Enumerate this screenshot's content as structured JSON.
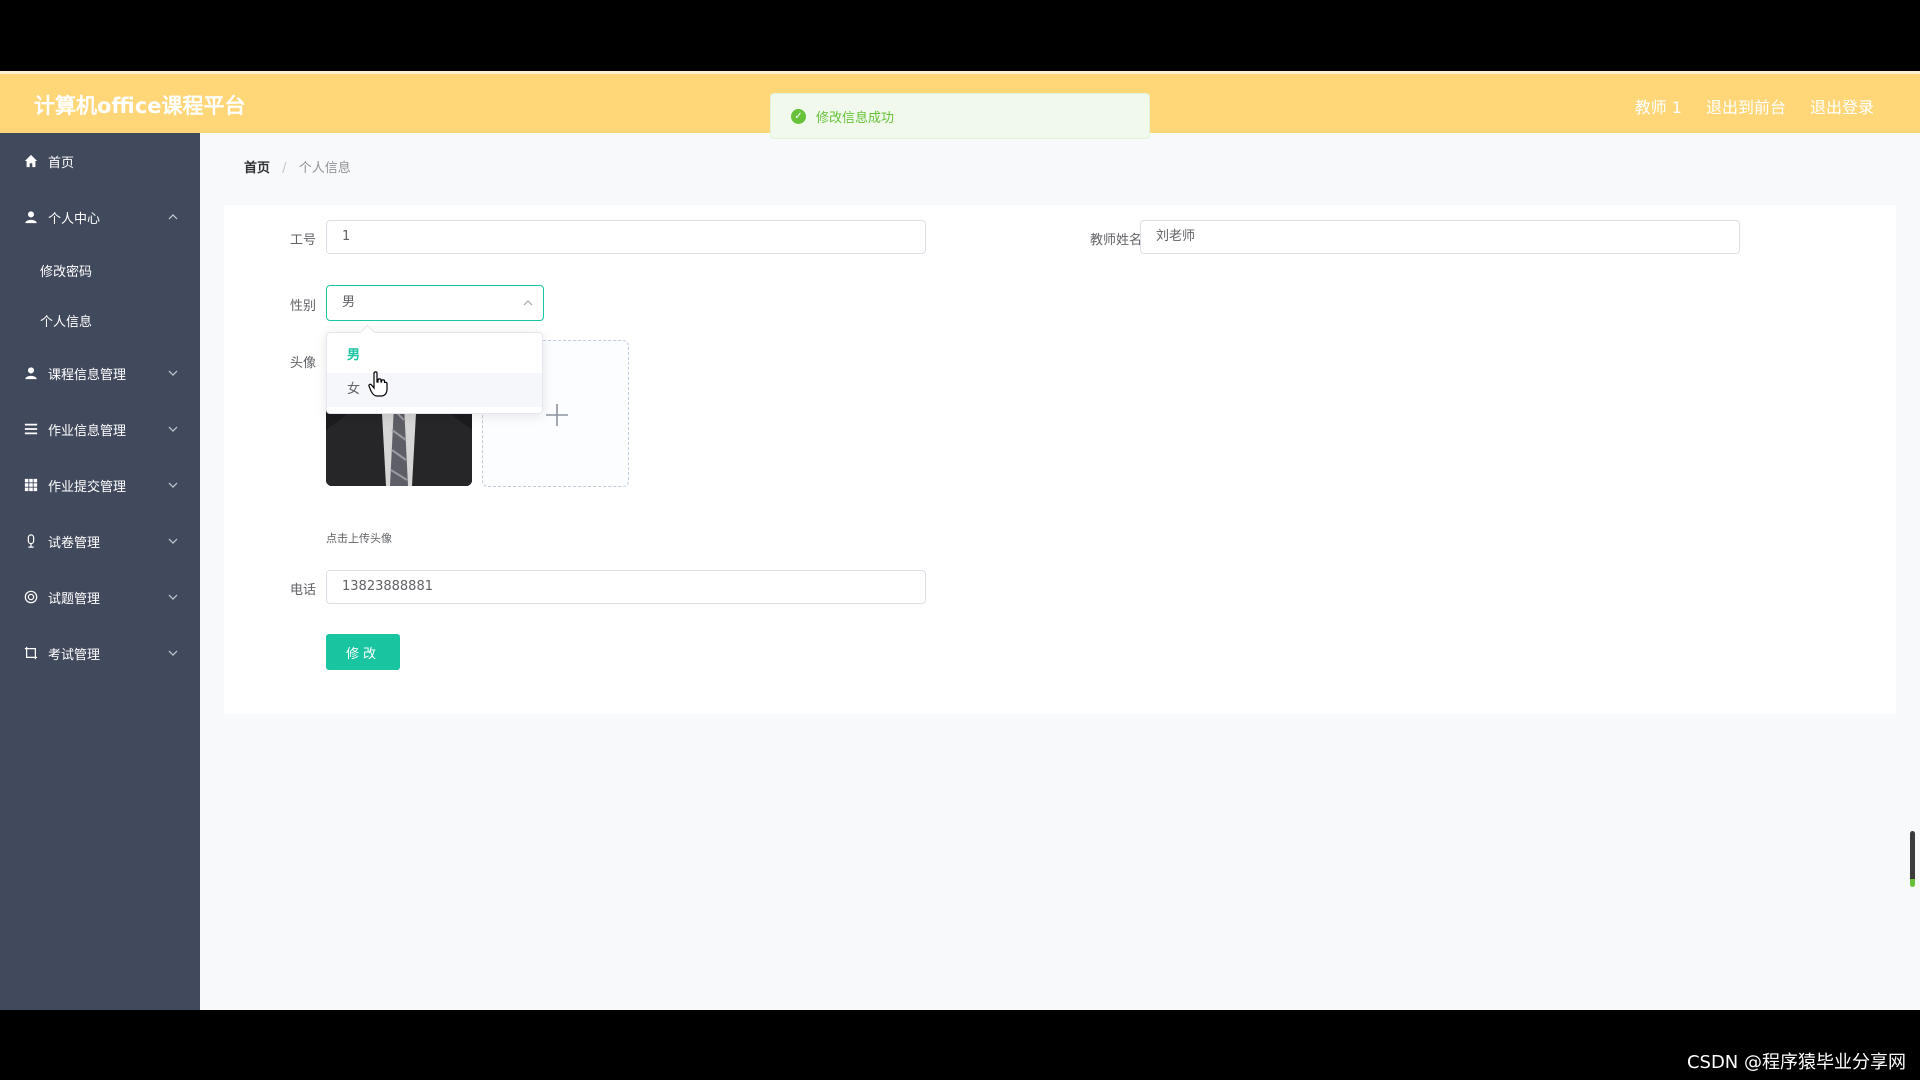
{
  "header": {
    "title": "计算机office课程平台",
    "links": [
      "教师 1",
      "退出到前台",
      "退出登录"
    ]
  },
  "toast": {
    "message": "修改信息成功"
  },
  "sidebar": {
    "items": [
      {
        "label": "首页",
        "icon": "home-icon"
      },
      {
        "label": "个人中心",
        "icon": "user-icon",
        "expanded": true,
        "children": [
          "修改密码",
          "个人信息"
        ]
      },
      {
        "label": "课程信息管理",
        "icon": "user-icon"
      },
      {
        "label": "作业信息管理",
        "icon": "list-icon"
      },
      {
        "label": "作业提交管理",
        "icon": "grid-icon"
      },
      {
        "label": "试卷管理",
        "icon": "mic-icon"
      },
      {
        "label": "试题管理",
        "icon": "circle-icon"
      },
      {
        "label": "考试管理",
        "icon": "crop-icon"
      }
    ]
  },
  "breadcrumb": {
    "home": "首页",
    "separator": "/",
    "current": "个人信息"
  },
  "form": {
    "job_no_label": "工号",
    "job_no_value": "1",
    "teacher_name_label": "教师姓名",
    "teacher_name_value": "刘老师",
    "gender_label": "性别",
    "gender_value": "男",
    "gender_options": [
      "男",
      "女"
    ],
    "avatar_label": "头像",
    "avatar_hint": "点击上传头像",
    "phone_label": "电话",
    "phone_value": "13823888881",
    "submit_label": "修改"
  },
  "watermark": "CSDN @程序猿毕业分享网",
  "colors": {
    "header_bg": "#ffd678",
    "sidebar_bg": "#414a5c",
    "accent": "#19c4a0",
    "success": "#67c23a"
  }
}
